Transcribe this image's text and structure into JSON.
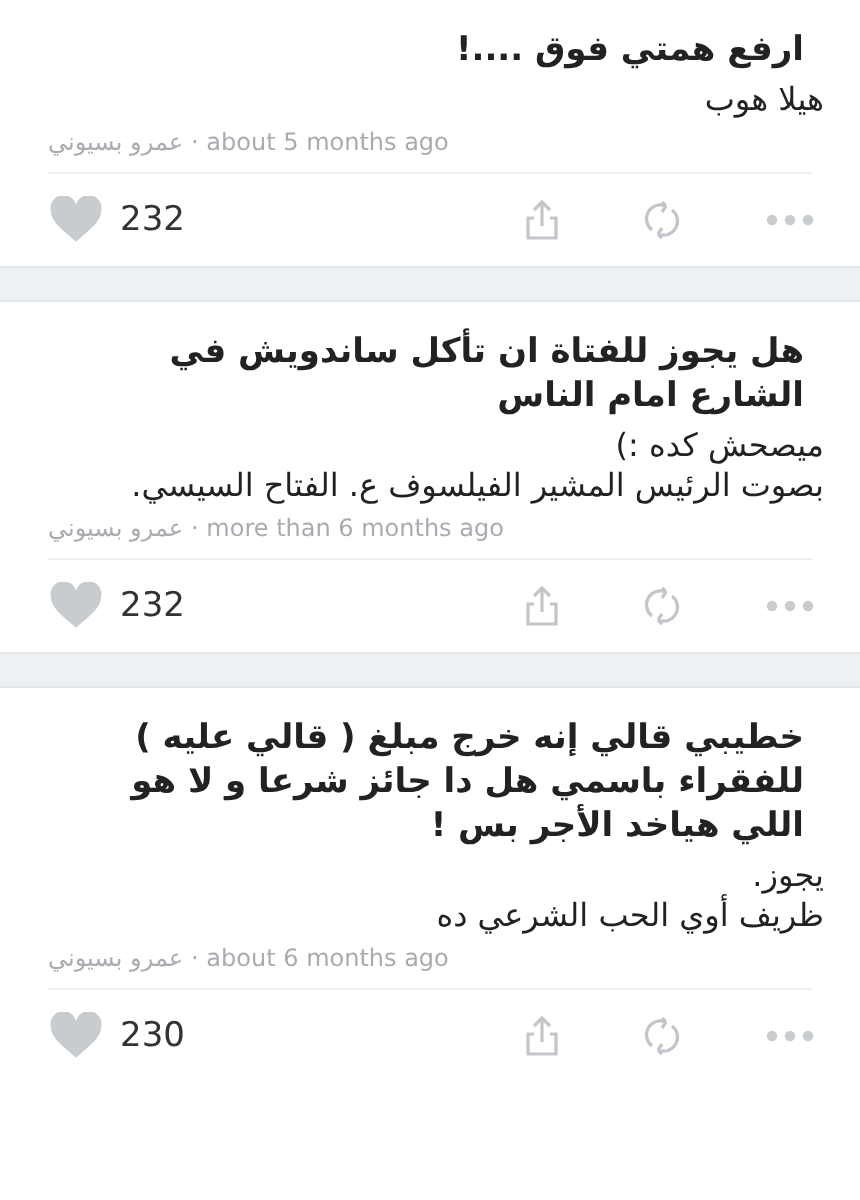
{
  "posts": [
    {
      "question": "ارفع همتي فوق ....!",
      "answer": [
        "هيلا هوب"
      ],
      "author": "عمرو بسيوني",
      "time": "· about 5 months ago",
      "likes": "232",
      "liked": false
    },
    {
      "question": "هل يجوز للفتاة ان تأكل ساندويش في الشارع امام الناس",
      "answer": [
        "ميصحش كده :)",
        "بصوت الرئيس المشير الفيلسوف ع. الفتاح السيسي."
      ],
      "author": "عمرو بسيوني",
      "time": "· more than 6 months ago",
      "likes": "232",
      "liked": false
    },
    {
      "question": "خطيبي قالي إنه خرج مبلغ ( قالي عليه ) للفقراء باسمي هل دا جائز شرعا و لا هو اللي هياخد الأجر بس !",
      "answer": [
        "يجوز.",
        "ظريف أوي الحب الشرعي ده"
      ],
      "author": "عمرو بسيوني",
      "time": "· about 6 months ago",
      "likes": "230",
      "liked": false
    }
  ]
}
